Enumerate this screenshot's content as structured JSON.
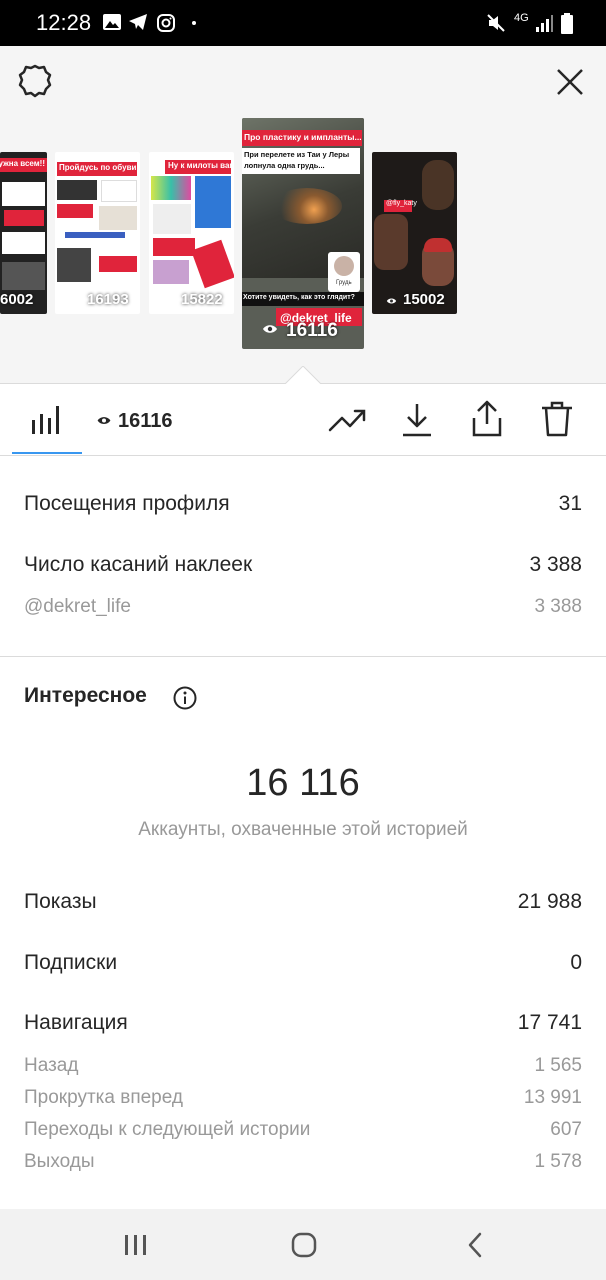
{
  "status_bar": {
    "time": "12:28",
    "network": "4G"
  },
  "stories": [
    {
      "count": "6002",
      "text": "нужна всем!!"
    },
    {
      "count": "16193",
      "text": "Пройдусь по обуви!"
    },
    {
      "count": "15822",
      "text": "Ну к милоты вам!!!"
    },
    {
      "count": "16116",
      "text_top": "Про пластику и импланты...",
      "text_mid": "При перелете из Таи у Леры лопнула одна грудь...",
      "text_bottom": "Хотите увидеть, как это глядит?",
      "tag": "@dekret_life",
      "label": "Грудь"
    },
    {
      "count": "15002",
      "tag": "@fly_katy"
    }
  ],
  "toolbar": {
    "views": "16116"
  },
  "profile_visits": {
    "label": "Посещения профиля",
    "value": "31"
  },
  "sticker_taps": {
    "label": "Число касаний наклеек",
    "value": "3 388"
  },
  "sticker_account": {
    "label": "@dekret_life",
    "value": "3 388"
  },
  "discovery": {
    "title": "Интересное",
    "big_number": "16 116",
    "caption": "Аккаунты, охваченные этой историей"
  },
  "metrics": {
    "impressions": {
      "label": "Показы",
      "value": "21 988"
    },
    "follows": {
      "label": "Подписки",
      "value": "0"
    },
    "navigation": {
      "label": "Навигация",
      "value": "17 741"
    },
    "back": {
      "label": "Назад",
      "value": "1 565"
    },
    "forward": {
      "label": "Прокрутка вперед",
      "value": "13 991"
    },
    "next_story": {
      "label": "Переходы к следующей истории",
      "value": "607"
    },
    "exits": {
      "label": "Выходы",
      "value": "1 578"
    }
  },
  "colors": {
    "accent": "#3897f0",
    "text": "#262626",
    "secondary": "#999999",
    "story_red": "#e0243b"
  }
}
